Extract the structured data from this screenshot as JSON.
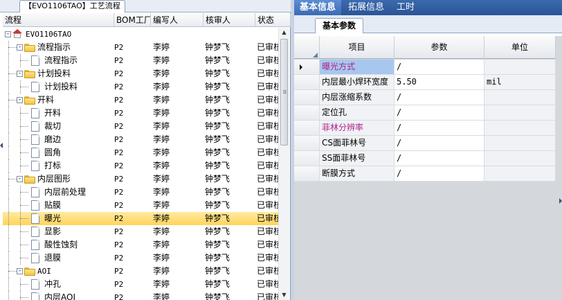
{
  "left_panel": {
    "tab_title": "【EVO1106TAO】工艺流程",
    "columns": [
      "流程",
      "BOM工厂",
      "编写人",
      "核审人",
      "状态"
    ]
  },
  "tree_rows": [
    {
      "label": "EVO1106TAO",
      "bom": "",
      "writer": "",
      "reviewer": "",
      "status": "",
      "level": 0,
      "icon": "home-icon",
      "expander": "-"
    },
    {
      "label": "流程指示",
      "bom": "P2",
      "writer": "李婷",
      "reviewer": "钟梦飞",
      "status": "已审核",
      "level": 1,
      "icon": "folder-icon",
      "expander": "-"
    },
    {
      "label": "流程指示",
      "bom": "P2",
      "writer": "李婷",
      "reviewer": "钟梦飞",
      "status": "已审核",
      "level": 2,
      "icon": "page-icon"
    },
    {
      "label": "计划投料",
      "bom": "P2",
      "writer": "李婷",
      "reviewer": "钟梦飞",
      "status": "已审核",
      "level": 1,
      "icon": "folder-icon",
      "expander": "-"
    },
    {
      "label": "计划投料",
      "bom": "P2",
      "writer": "李婷",
      "reviewer": "钟梦飞",
      "status": "已审核",
      "level": 2,
      "icon": "page-icon"
    },
    {
      "label": "开料",
      "bom": "P2",
      "writer": "李婷",
      "reviewer": "钟梦飞",
      "status": "已审核",
      "level": 1,
      "icon": "folder-icon",
      "expander": "-"
    },
    {
      "label": "开料",
      "bom": "P2",
      "writer": "李婷",
      "reviewer": "钟梦飞",
      "status": "已审核",
      "level": 2,
      "icon": "page-icon"
    },
    {
      "label": "裁切",
      "bom": "P2",
      "writer": "李婷",
      "reviewer": "钟梦飞",
      "status": "已审核",
      "level": 2,
      "icon": "page-icon"
    },
    {
      "label": "磨边",
      "bom": "P2",
      "writer": "李婷",
      "reviewer": "钟梦飞",
      "status": "已审核",
      "level": 2,
      "icon": "page-icon"
    },
    {
      "label": "圆角",
      "bom": "P2",
      "writer": "李婷",
      "reviewer": "钟梦飞",
      "status": "已审核",
      "level": 2,
      "icon": "page-icon"
    },
    {
      "label": "打标",
      "bom": "P2",
      "writer": "李婷",
      "reviewer": "钟梦飞",
      "status": "已审核",
      "level": 2,
      "icon": "page-icon"
    },
    {
      "label": "内层图形",
      "bom": "P2",
      "writer": "李婷",
      "reviewer": "钟梦飞",
      "status": "已审核",
      "level": 1,
      "icon": "folder-icon",
      "expander": "-"
    },
    {
      "label": "内层前处理",
      "bom": "P2",
      "writer": "李婷",
      "reviewer": "钟梦飞",
      "status": "已审核",
      "level": 2,
      "icon": "page-icon"
    },
    {
      "label": "贴膜",
      "bom": "P2",
      "writer": "李婷",
      "reviewer": "钟梦飞",
      "status": "已审核",
      "level": 2,
      "icon": "page-icon"
    },
    {
      "label": "曝光",
      "bom": "P2",
      "writer": "李婷",
      "reviewer": "钟梦飞",
      "status": "已审核",
      "level": 2,
      "icon": "page-icon",
      "selected": true
    },
    {
      "label": "显影",
      "bom": "P2",
      "writer": "李婷",
      "reviewer": "钟梦飞",
      "status": "已审核",
      "level": 2,
      "icon": "page-icon"
    },
    {
      "label": "酸性蚀刻",
      "bom": "P2",
      "writer": "李婷",
      "reviewer": "钟梦飞",
      "status": "已审核",
      "level": 2,
      "icon": "page-icon"
    },
    {
      "label": "退膜",
      "bom": "P2",
      "writer": "李婷",
      "reviewer": "钟梦飞",
      "status": "已审核",
      "level": 2,
      "icon": "page-icon"
    },
    {
      "label": "AOI",
      "bom": "P2",
      "writer": "李婷",
      "reviewer": "钟梦飞",
      "status": "已审核",
      "level": 1,
      "icon": "folder-icon",
      "expander": "-"
    },
    {
      "label": "冲孔",
      "bom": "P2",
      "writer": "李婷",
      "reviewer": "钟梦飞",
      "status": "已审核",
      "level": 2,
      "icon": "page-icon"
    },
    {
      "label": "内层AOI",
      "bom": "P2",
      "writer": "李婷",
      "reviewer": "钟梦飞",
      "status": "已审核",
      "level": 2,
      "icon": "page-icon"
    }
  ],
  "right_panel": {
    "top_tabs": [
      "基本信息",
      "拓展信息",
      "工时"
    ],
    "sub_tab": "基本参数",
    "columns": [
      "项目",
      "参数",
      "单位"
    ],
    "rows": [
      {
        "item": "曝光方式",
        "param": "/",
        "unit": "",
        "highlight": true,
        "current": true
      },
      {
        "item": "内层最小焊环宽度",
        "param": "5.50",
        "unit": "mil"
      },
      {
        "item": "内层涨缩系数",
        "param": "/",
        "unit": ""
      },
      {
        "item": "定位孔",
        "param": "/",
        "unit": ""
      },
      {
        "item": "菲林分辨率",
        "param": "/",
        "unit": "",
        "highlight": true
      },
      {
        "item": "CS面菲林号",
        "param": "/",
        "unit": ""
      },
      {
        "item": "SS面菲林号",
        "param": "/",
        "unit": ""
      },
      {
        "item": "断膜方式",
        "param": "/",
        "unit": ""
      }
    ]
  }
}
